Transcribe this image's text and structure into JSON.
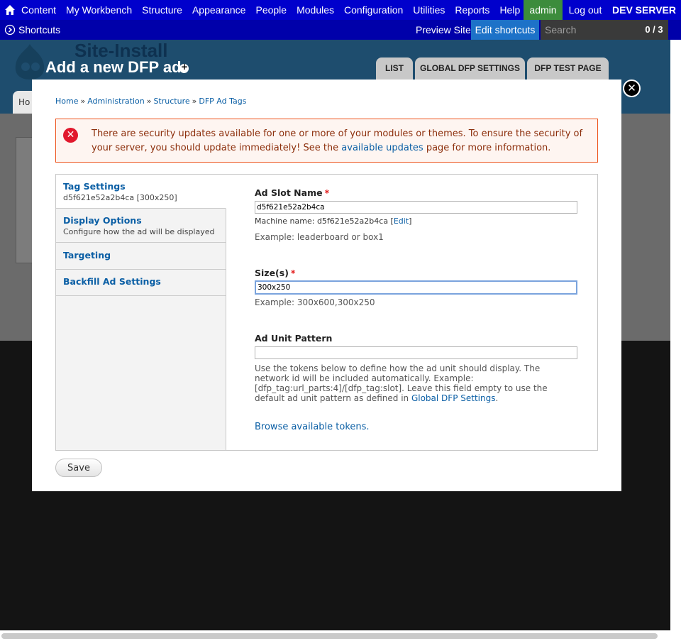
{
  "toolbar": {
    "menu": [
      "Content",
      "My Workbench",
      "Structure",
      "Appearance",
      "People",
      "Modules",
      "Configuration",
      "Utilities",
      "Reports",
      "Help"
    ],
    "user": "admin",
    "logout": "Log out",
    "environment": "DEV SERVER"
  },
  "shortcuts": {
    "label": "Shortcuts",
    "preview": "Preview Site",
    "edit": "Edit shortcuts",
    "search_placeholder": "Search",
    "counter": "0 / 3"
  },
  "page": {
    "site_name": "Site-Install",
    "title": "Add a new DFP ad",
    "tabs": [
      "LIST",
      "GLOBAL DFP SETTINGS",
      "DFP TEST PAGE"
    ],
    "home_tab": "Ho"
  },
  "modal": {
    "breadcrumb": [
      "Home",
      "Administration",
      "Structure",
      "DFP Ad Tags"
    ],
    "breadcrumb_sep": "»",
    "alert": {
      "text_before": "There are security updates available for one or more of your modules or themes. To ensure the security of your server, you should update immediately! See the ",
      "link": "available updates",
      "text_after": " page for more information."
    },
    "vertical_tabs": [
      {
        "title": "Tag Settings",
        "summary": "d5f621e52a2b4ca [300x250]"
      },
      {
        "title": "Display Options",
        "summary": "Configure how the ad will be displayed"
      },
      {
        "title": "Targeting",
        "summary": ""
      },
      {
        "title": "Backfill Ad Settings",
        "summary": ""
      }
    ],
    "fields": {
      "slot_name": {
        "label": "Ad Slot Name",
        "required": "*",
        "value": "d5f621e52a2b4ca",
        "machine_prefix": "Machine name: d5f621e52a2b4ca [",
        "machine_edit": "Edit",
        "machine_suffix": "]",
        "example": "Example: leaderboard or box1"
      },
      "sizes": {
        "label": "Size(s)",
        "required": "*",
        "value": "300x250",
        "example": "Example: 300x600,300x250"
      },
      "pattern": {
        "label": "Ad Unit Pattern",
        "value": "",
        "desc_before": "Use the tokens below to define how the ad unit should display. The network id will be included automatically. Example: [dfp_tag:url_parts:4]/[dfp_tag:slot]. Leave this field empty to use the default ad unit pattern as defined in ",
        "desc_link": "Global DFP Settings",
        "desc_after": ".",
        "browse": "Browse available tokens."
      }
    },
    "save": "Save",
    "close_glyph": "✕"
  }
}
